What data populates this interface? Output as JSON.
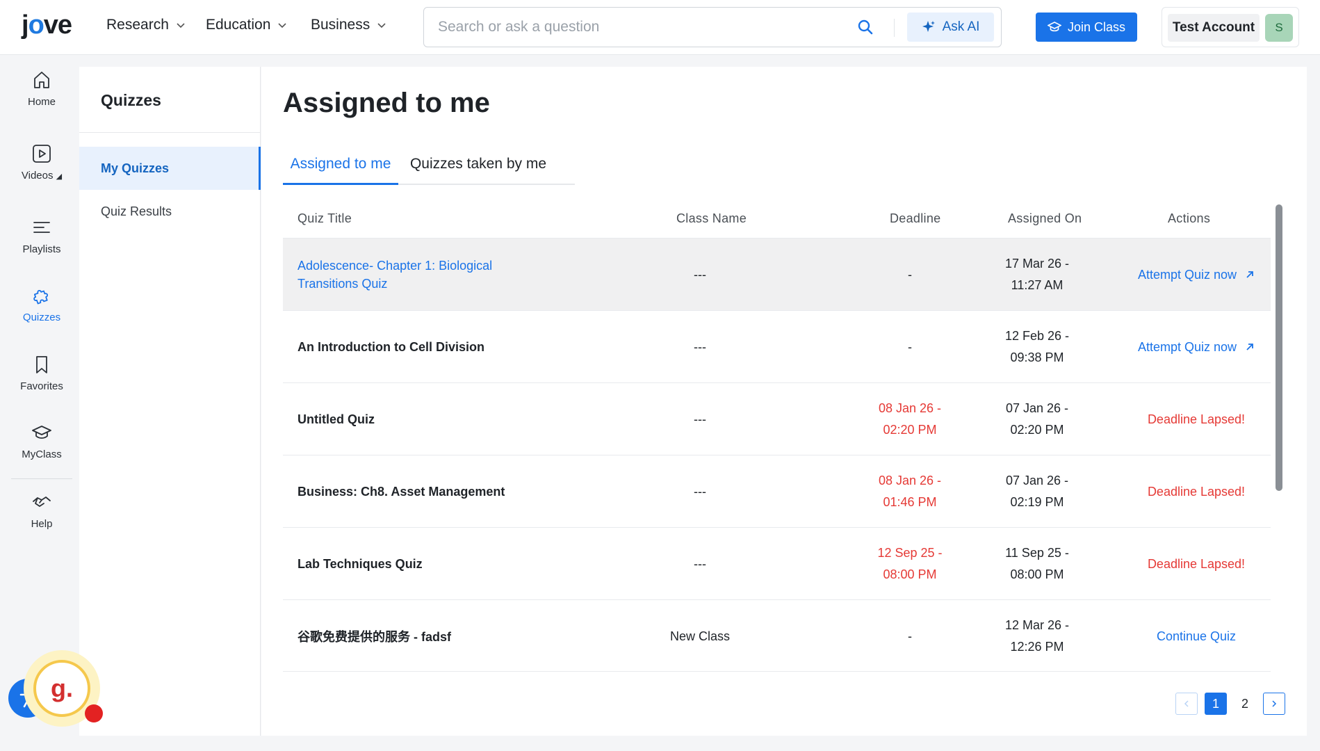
{
  "header": {
    "logo_text": "jove",
    "nav": [
      {
        "label": "Research"
      },
      {
        "label": "Education"
      },
      {
        "label": "Business"
      }
    ],
    "search_placeholder": "Search or ask a question",
    "ask_ai_label": "Ask AI",
    "join_class_label": "Join Class",
    "account_name": "Test Account",
    "avatar_initial": "S"
  },
  "rail": {
    "items": [
      {
        "label": "Home",
        "icon": "home-icon"
      },
      {
        "label": "Videos",
        "icon": "video-icon"
      },
      {
        "label": "Playlists",
        "icon": "playlist-icon"
      },
      {
        "label": "Quizzes",
        "icon": "puzzle-icon"
      },
      {
        "label": "Favorites",
        "icon": "bookmark-icon"
      },
      {
        "label": "MyClass",
        "icon": "graduation-cap-icon"
      },
      {
        "label": "Help",
        "icon": "handshake-icon"
      }
    ],
    "active": "Quizzes"
  },
  "subsidebar": {
    "title": "Quizzes",
    "items": [
      {
        "label": "My Quizzes"
      },
      {
        "label": "Quiz Results"
      }
    ]
  },
  "main": {
    "title": "Assigned to me",
    "tabs": [
      {
        "label": "Assigned to me"
      },
      {
        "label": "Quizzes taken by me"
      }
    ],
    "columns": [
      "Quiz Title",
      "Class Name",
      "Deadline",
      "Assigned On",
      "Actions"
    ],
    "rows": [
      {
        "title": "Adolescence- Chapter 1: Biological Transitions Quiz",
        "class": "---",
        "deadline": "-",
        "assigned": "17 Mar 26 - 11:27 AM",
        "action": "Attempt Quiz now"
      },
      {
        "title": "An Introduction to Cell Division",
        "class": "---",
        "deadline": "-",
        "assigned": "12 Feb 26 - 09:38 PM",
        "action": "Attempt Quiz now"
      },
      {
        "title": "Untitled Quiz",
        "class": "---",
        "deadline": "08 Jan 26 - 02:20 PM",
        "assigned": "07 Jan 26 - 02:20 PM",
        "action": "Deadline Lapsed!"
      },
      {
        "title": "Business: Ch8. Asset Management",
        "class": "---",
        "deadline": "08 Jan 26 - 01:46 PM",
        "assigned": "07 Jan 26 - 02:19 PM",
        "action": "Deadline Lapsed!"
      },
      {
        "title": "Lab Techniques Quiz",
        "class": "---",
        "deadline": "12 Sep 25 - 08:00 PM",
        "assigned": "11 Sep 25 - 08:00 PM",
        "action": "Deadline Lapsed!"
      },
      {
        "title": "谷歌免费提供的服务 - fadsf",
        "class": "New Class",
        "deadline": "-",
        "assigned": "12 Mar 26 - 12:26 PM",
        "action": "Continue Quiz"
      }
    ],
    "pagination": {
      "pages": [
        "1",
        "2"
      ],
      "current": "1"
    }
  },
  "widgets": {
    "grammarly_letter": "g."
  },
  "colors": {
    "accent": "#1a73e8",
    "danger": "#e53935",
    "avatar_bg": "#a8d5b8"
  }
}
